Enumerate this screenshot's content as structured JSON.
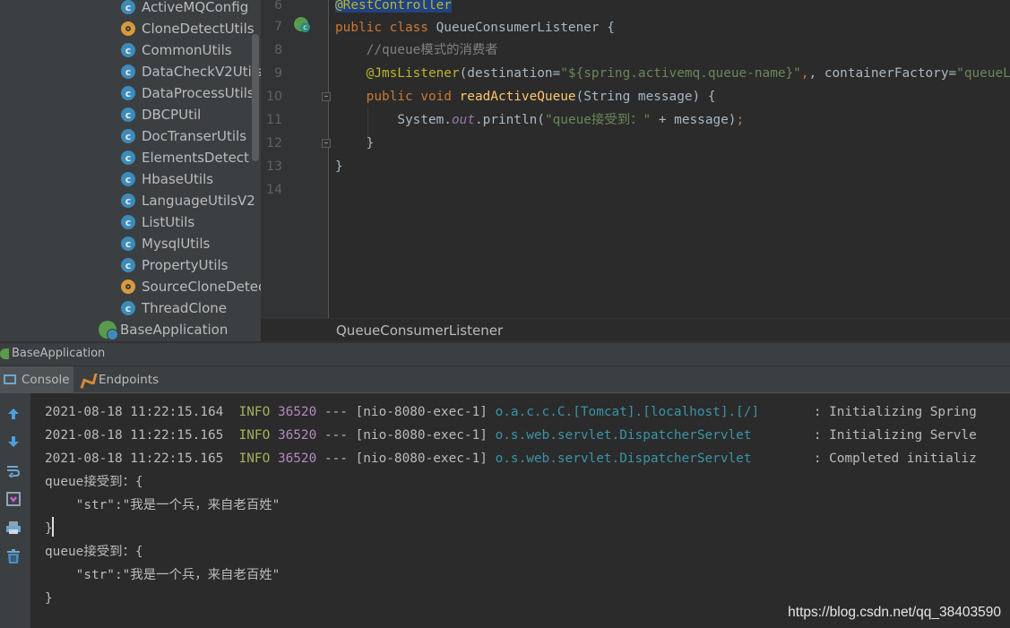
{
  "project_tree": {
    "items": [
      {
        "label": "ActiveMQConfig",
        "icon": "class-icon"
      },
      {
        "label": "CloneDetectUtils",
        "icon": "util-class-icon"
      },
      {
        "label": "CommonUtils",
        "icon": "class-icon"
      },
      {
        "label": "DataCheckV2Utils",
        "icon": "class-icon"
      },
      {
        "label": "DataProcessUtils",
        "icon": "class-icon"
      },
      {
        "label": "DBCPUtil",
        "icon": "class-icon"
      },
      {
        "label": "DocTranserUtils",
        "icon": "class-icon"
      },
      {
        "label": "ElementsDetect",
        "icon": "class-icon"
      },
      {
        "label": "HbaseUtils",
        "icon": "class-icon"
      },
      {
        "label": "LanguageUtilsV2",
        "icon": "class-icon"
      },
      {
        "label": "ListUtils",
        "icon": "class-icon"
      },
      {
        "label": "MysqlUtils",
        "icon": "class-icon"
      },
      {
        "label": "PropertyUtils",
        "icon": "class-icon"
      },
      {
        "label": "SourceCloneDetec",
        "icon": "util-class-icon"
      },
      {
        "label": "ThreadClone",
        "icon": "class-icon"
      }
    ],
    "root_item": {
      "label": "BaseApplication",
      "icon": "spring-boot-icon"
    }
  },
  "editor": {
    "line_numbers": [
      "6",
      "7",
      "8",
      "9",
      "10",
      "11",
      "12",
      "13",
      "14"
    ],
    "code": {
      "l6_annotation": "@RestController",
      "l7_kw1": "public class ",
      "l7_name": "QueueConsumerListener {",
      "l8_comment": "//queue模式的消费者",
      "l9_annotation": "@JmsListener",
      "l9_a": "(destination=",
      "l9_str1": "\"${spring.activemq.queue-name}\"",
      "l9_b": ", containerFactory=",
      "l9_str2": "\"queueListener\")",
      "l10_kw": "public void ",
      "l10_fn": "readActiveQueue",
      "l10_rest": "(String message) {",
      "l11_a": "System.",
      "l11_field": "out",
      "l11_b": ".println(",
      "l11_str": "\"queue接受到：\"",
      "l11_c": " + message)",
      "l11_semi": ";",
      "l12": "}",
      "l13": "}"
    },
    "breadcrumb": "QueueConsumerListener"
  },
  "run_window": {
    "title": "BaseApplication",
    "tabs": [
      {
        "label": "Console"
      },
      {
        "label": "Endpoints"
      }
    ],
    "console_lines": [
      {
        "time": "2021-08-18 11:22:15.164",
        "level": "INFO",
        "pid": "36520",
        "sep": "---",
        "thread": "[nio-8080-exec-1]",
        "logger": "o.a.c.c.C.[Tomcat].[localhost].[/]      ",
        "msg": ": Initializing Spring"
      },
      {
        "time": "2021-08-18 11:22:15.165",
        "level": "INFO",
        "pid": "36520",
        "sep": "---",
        "thread": "[nio-8080-exec-1]",
        "logger": "o.s.web.servlet.DispatcherServlet       ",
        "msg": ": Initializing Servle"
      },
      {
        "time": "2021-08-18 11:22:15.165",
        "level": "INFO",
        "pid": "36520",
        "sep": "---",
        "thread": "[nio-8080-exec-1]",
        "logger": "o.s.web.servlet.DispatcherServlet       ",
        "msg": ": Completed initializ"
      }
    ],
    "messages": [
      "queue接受到：{",
      "    \"str\":\"我是一个兵，来自老百姓\"",
      "}",
      "queue接受到：{",
      "    \"str\":\"我是一个兵，来自老百姓\"",
      "}"
    ]
  },
  "watermark": "https://blog.csdn.net/qq_38403590",
  "colors": {
    "keyword": "#cc7832",
    "annotation": "#bbb529",
    "string": "#6a8759",
    "method": "#ffc66d",
    "info": "#a8b05c",
    "logger": "#3a94a8"
  }
}
